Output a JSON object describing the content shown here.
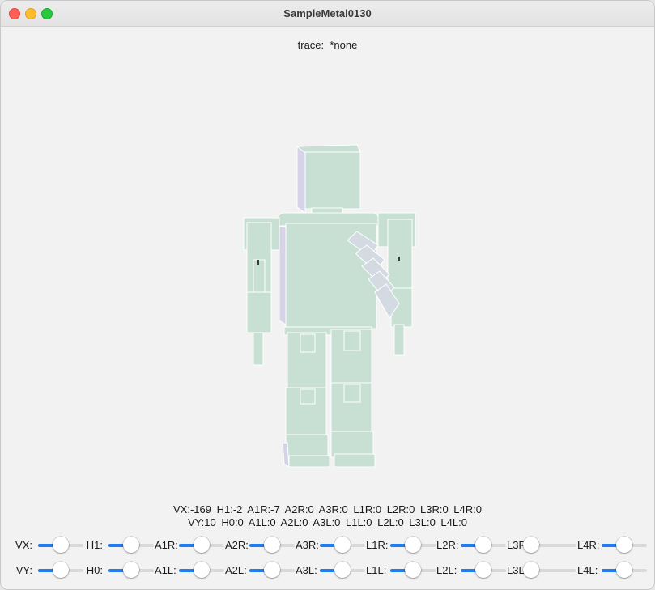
{
  "window": {
    "title": "SampleMetal0130"
  },
  "trace": {
    "label": "trace:",
    "value": "*none"
  },
  "readout": {
    "line1": "VX:-169  H1:-2  A1R:-7  A2R:0  A3R:0  L1R:0  L2R:0  L3R:0  L4R:0",
    "line2": "VY:10  H0:0  A1L:0  A2L:0  A3L:0  L1L:0  L2L:0  L3L:0  L4L:0"
  },
  "sliders": {
    "row1": [
      {
        "label": "VX:",
        "value": 0.5
      },
      {
        "label": "H1:",
        "value": 0.5
      },
      {
        "label": "A1R:",
        "value": 0.5
      },
      {
        "label": "A2R:",
        "value": 0.5
      },
      {
        "label": "A3R:",
        "value": 0.5
      },
      {
        "label": "L1R:",
        "value": 0.5
      },
      {
        "label": "L2R:",
        "value": 0.5
      },
      {
        "label": "L3R:",
        "value": 0.0
      },
      {
        "label": "L4R:",
        "value": 0.5
      }
    ],
    "row2": [
      {
        "label": "VY:",
        "value": 0.5
      },
      {
        "label": "H0:",
        "value": 0.5
      },
      {
        "label": "A1L:",
        "value": 0.5
      },
      {
        "label": "A2L:",
        "value": 0.5
      },
      {
        "label": "A3L:",
        "value": 0.5
      },
      {
        "label": "L1L:",
        "value": 0.5
      },
      {
        "label": "L2L:",
        "value": 0.5
      },
      {
        "label": "L3L:",
        "value": 0.0
      },
      {
        "label": "L4L:",
        "value": 0.5
      }
    ]
  },
  "colors": {
    "robot_body": "#c7e0d3",
    "robot_shadow": "#d6d3e8",
    "robot_arm_segments": "#d3dae2",
    "slider_accent": "#1e7cf5"
  }
}
